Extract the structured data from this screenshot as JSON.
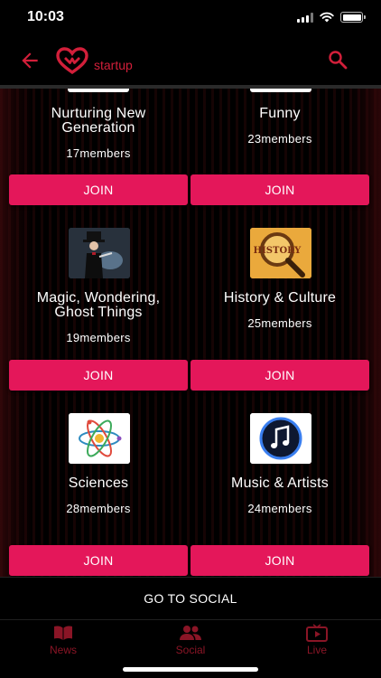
{
  "status": {
    "time": "10:03"
  },
  "header": {
    "brand": "startup"
  },
  "cards": [
    {
      "title_lines": [
        "Nurturing New",
        "Generation"
      ],
      "members": "17members",
      "join": "JOIN",
      "icon": "community-icon"
    },
    {
      "title_lines": [
        "Funny"
      ],
      "members": "23members",
      "join": "JOIN",
      "icon": "funny-icon"
    },
    {
      "title_lines": [
        "Magic, Wondering,",
        "Ghost Things"
      ],
      "members": "19members",
      "join": "JOIN",
      "icon": "magician-icon"
    },
    {
      "title_lines": [
        "History & Culture"
      ],
      "members": "25members",
      "join": "JOIN",
      "icon": "history-icon",
      "icon_text": "HISTORY"
    },
    {
      "title_lines": [
        "Sciences"
      ],
      "members": "28members",
      "join": "JOIN",
      "icon": "atom-icon"
    },
    {
      "title_lines": [
        "Music & Artists"
      ],
      "members": "24members",
      "join": "JOIN",
      "icon": "music-note-icon"
    }
  ],
  "social_bar": {
    "label": "GO TO SOCIAL"
  },
  "nav": [
    {
      "label": "News",
      "icon": "book-icon"
    },
    {
      "label": "Social",
      "icon": "people-icon"
    },
    {
      "label": "Live",
      "icon": "tv-play-icon"
    }
  ],
  "colors": {
    "accent": "#e4175a",
    "brand_red": "#d21f3a",
    "nav_red": "#8a1526",
    "background": "#000000"
  }
}
